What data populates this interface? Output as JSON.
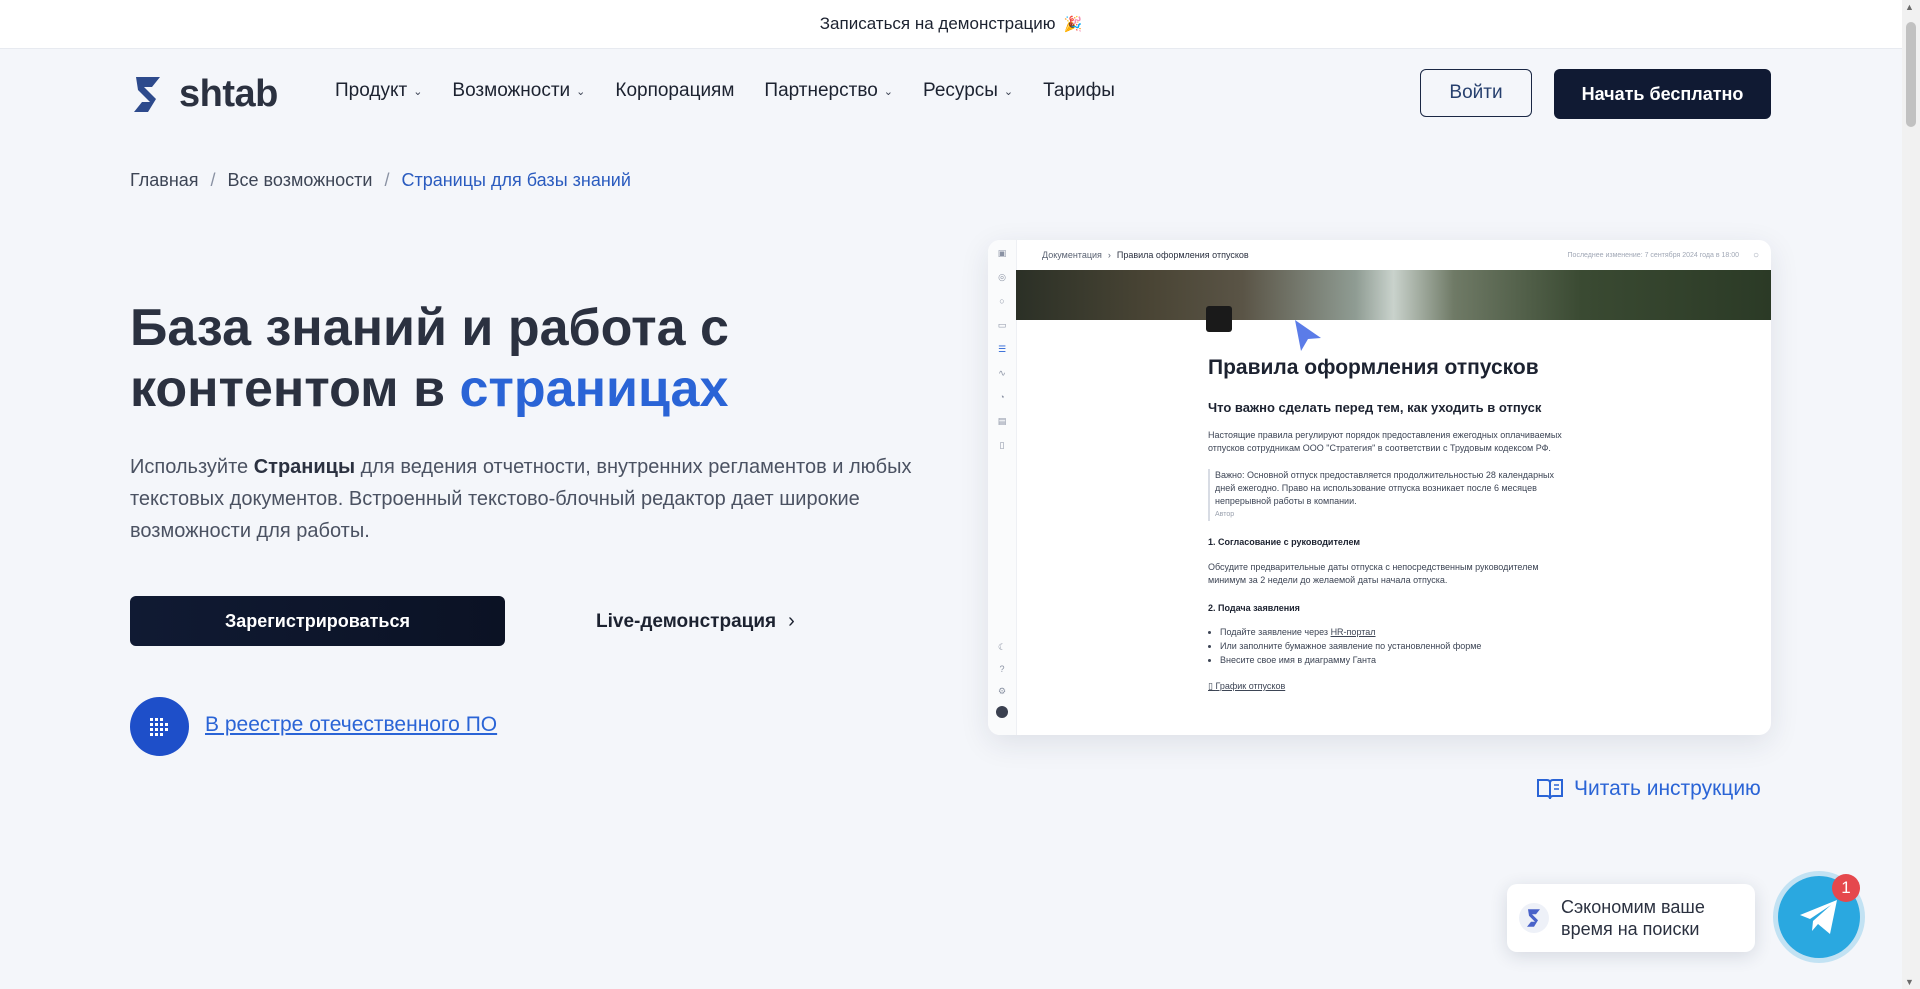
{
  "announcement": {
    "text": "Записаться на демонстрацию",
    "emoji": "🎉"
  },
  "header": {
    "logo_text": "shtab",
    "nav": [
      {
        "label": "Продукт",
        "has_dropdown": true
      },
      {
        "label": "Возможности",
        "has_dropdown": true
      },
      {
        "label": "Корпорациям",
        "has_dropdown": false
      },
      {
        "label": "Партнерство",
        "has_dropdown": true
      },
      {
        "label": "Ресурсы",
        "has_dropdown": true
      },
      {
        "label": "Тарифы",
        "has_dropdown": false
      }
    ],
    "login_label": "Войти",
    "start_label": "Начать бесплатно"
  },
  "breadcrumb": {
    "home": "Главная",
    "all_features": "Все возможности",
    "current": "Страницы для базы знаний"
  },
  "hero": {
    "title_part1": "База знаний и работа с контентом в",
    "title_accent": "страницах",
    "desc_prefix": "Используйте",
    "desc_bold": "Страницы",
    "desc_rest": "для ведения отчетности, внутренних регламентов и любых текстовых документов. Встроенный текстово-блочный редактор дает широкие возможности для работы.",
    "register_label": "Зарегистрироваться",
    "live_demo_label": "Live-демонстрация",
    "registry_link": "В реестре отечественного ПО",
    "read_instruction": "Читать инструкцию"
  },
  "preview": {
    "crumb_root": "Документация",
    "crumb_current": "Правила оформления отпусков",
    "edited": "Последнее изменение: 7 сентября 2024 года в 18:00",
    "doc_title": "Правила оформления отпусков",
    "doc_subtitle": "Что важно сделать перед тем, как уходить в отпуск",
    "para1": "Настоящие правила регулируют порядок предоставления ежегодных оплачиваемых отпусков сотрудникам ООО \"Стратегия\" в соответствии с Трудовым кодексом РФ.",
    "quote": "Важно: Основной отпуск предоставляется продолжительностью 28 календарных дней ежегодно. Право на использование отпуска возникает после 6 месяцев непрерывной работы в компании.",
    "quote_author": "Автор",
    "section1": "1. Согласование с руководителем",
    "para2": "Обсудите предварительные даты отпуска с непосредственным руководителем минимум за 2 недели до желаемой даты начала отпуска.",
    "section2": "2. Подача заявления",
    "list": [
      {
        "prefix": "Подайте заявление через ",
        "link": "HR-портал"
      },
      {
        "prefix": "Или заполните бумажное заявление по установленной форме",
        "link": ""
      },
      {
        "prefix": "Внесите свое имя в диаграмму Ганта",
        "link": ""
      }
    ],
    "file": "График отпусков"
  },
  "chat": {
    "bubble_text": "Сэкономим ваше время на поиски",
    "badge_count": "1"
  },
  "colors": {
    "accent": "#2a64d6",
    "dark_button": "#101a33",
    "background": "#f4f6fa",
    "telegram": "#2aa8e0",
    "badge": "#e5484d"
  },
  "icons": [
    "shtab-logo",
    "chevron-down-icon",
    "chevron-right-icon",
    "registry-icon",
    "book-icon",
    "telegram-icon",
    "cursor-icon"
  ]
}
